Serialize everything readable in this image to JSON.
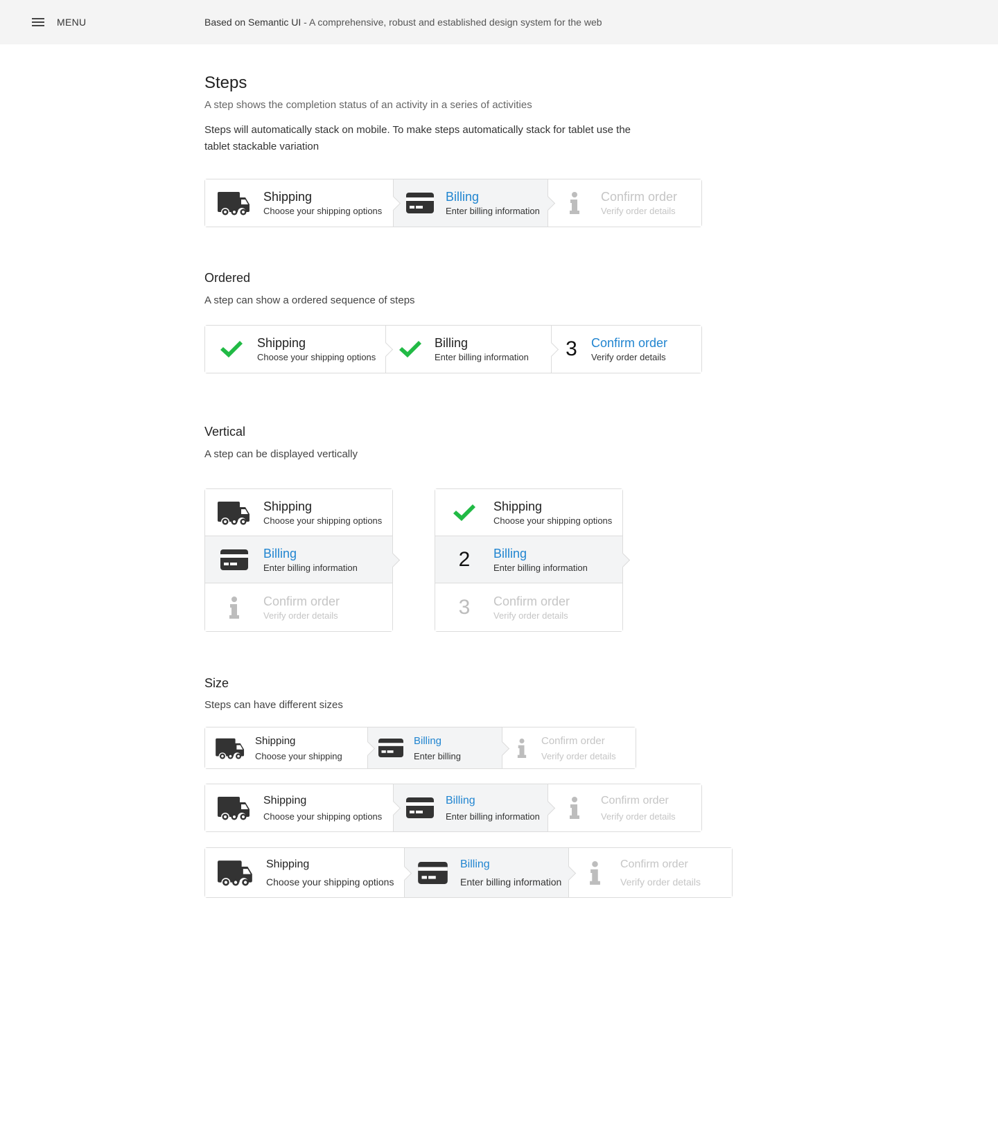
{
  "topbar": {
    "menu_label": "MENU",
    "brand": "Based on Semantic UI",
    "tagline": " - A comprehensive, robust and established design system for the web"
  },
  "intro": {
    "title": "Steps",
    "subtitle": "A step shows the completion status of an activity in a series of activities",
    "paragraph": "Steps will automatically stack on mobile. To make steps automatically stack for tablet use the tablet stackable variation"
  },
  "ordered": {
    "title": "Ordered",
    "description": "A step can show a ordered sequence of steps"
  },
  "vertical": {
    "title": "Vertical",
    "description": "A step can be displayed vertically"
  },
  "size": {
    "title": "Size",
    "description": "Steps can have different sizes"
  },
  "steps": {
    "shipping": {
      "title": "Shipping",
      "desc": "Choose your shipping options",
      "desc_short": "Choose your shipping"
    },
    "billing": {
      "title": "Billing",
      "desc": "Enter billing information",
      "desc_short": "Enter billing"
    },
    "confirm": {
      "title": "Confirm order",
      "desc": "Verify order details"
    }
  },
  "numbers": {
    "two": "2",
    "three": "3"
  },
  "icons": {
    "shipping": "truck-icon",
    "billing": "credit-card-icon",
    "confirm": "info-icon",
    "completed": "check-icon"
  },
  "colors": {
    "active": "#2185d0",
    "completed": "#21ba45",
    "disabled": "#c5c5c5",
    "active_bg": "#f3f4f5",
    "topbar_bg": "#f4f4f4"
  }
}
